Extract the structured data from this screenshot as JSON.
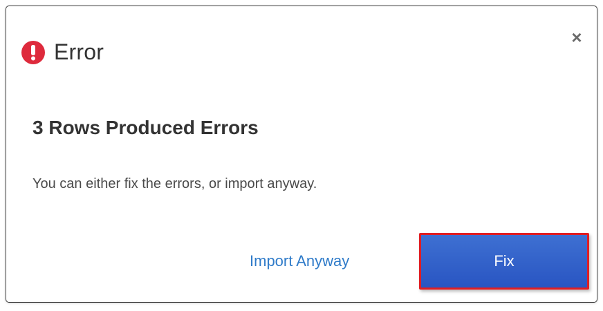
{
  "dialog": {
    "title": "Error",
    "close_symbol": "×",
    "heading": "3 Rows Produced Errors",
    "message": "You can either fix the errors, or import anyway.",
    "import_anyway_label": "Import Anyway",
    "fix_label": "Fix",
    "icons": {
      "title_icon": "error-exclamation-icon",
      "close_icon": "close-icon"
    },
    "colors": {
      "error_red": "#de2a3c",
      "link_blue": "#2f7bc9",
      "button_blue": "#3660c8",
      "highlight_red": "#e01e23"
    }
  }
}
